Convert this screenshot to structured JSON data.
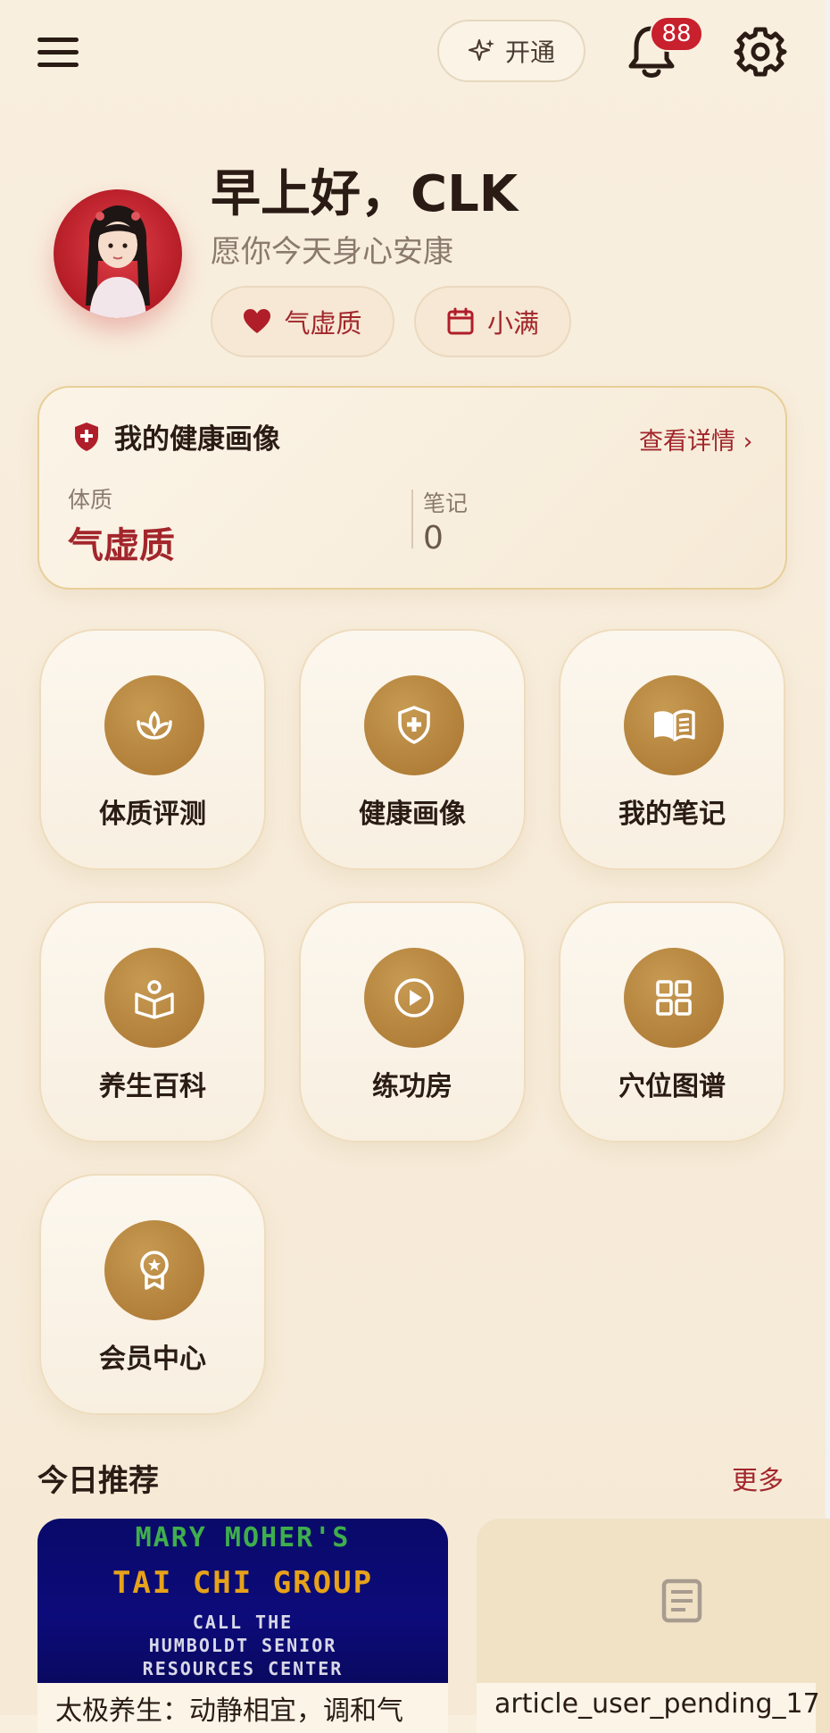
{
  "topbar": {
    "open_label": "开通",
    "notification_count": "88"
  },
  "greeting": {
    "title": "早上好，CLK",
    "subtitle": "愿你今天身心安康",
    "chips": [
      {
        "label": "气虚质",
        "icon": "heart-icon"
      },
      {
        "label": "小满",
        "icon": "calendar-icon"
      }
    ]
  },
  "health_profile": {
    "title": "我的健康画像",
    "detail_link": "查看详情 ›",
    "constitution_label": "体质",
    "constitution_value": "气虚质",
    "notes_label": "笔记",
    "notes_value": "0"
  },
  "features": [
    {
      "label": "体质评测",
      "icon": "sprout-icon"
    },
    {
      "label": "健康画像",
      "icon": "shield-plus-icon"
    },
    {
      "label": "我的笔记",
      "icon": "book-icon"
    },
    {
      "label": "养生百科",
      "icon": "reader-book-icon"
    },
    {
      "label": "练功房",
      "icon": "play-circle-icon"
    },
    {
      "label": "穴位图谱",
      "icon": "grid-icon"
    },
    {
      "label": "会员中心",
      "icon": "award-icon"
    }
  ],
  "recommend": {
    "title": "今日推荐",
    "more": "更多",
    "cards": [
      {
        "thumb_lines": [
          "MARY MOHER'S",
          "TAI CHI GROUP",
          "CALL THE",
          "HUMBOLDT SENIOR",
          "RESOURCES CENTER"
        ],
        "caption": "太极养生：动静相宜，调和气"
      },
      {
        "thumb_icon": "document-icon",
        "caption": "article_user_pending_17"
      }
    ]
  },
  "colors": {
    "accent_red": "#a2262c",
    "badge_red": "#c8202c",
    "gold": "#b38440",
    "background": "#f8eddc"
  }
}
